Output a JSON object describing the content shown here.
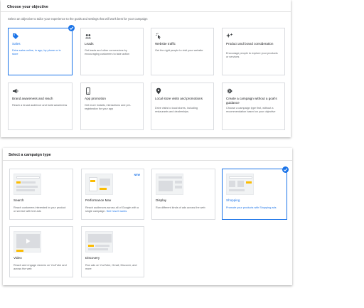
{
  "objective_panel": {
    "title": "Choose your objective",
    "subtitle": "Select an objective to tailor your experience to the goals and settings that will work best for your campaign",
    "cards": [
      {
        "icon": "tag-icon",
        "title": "Sales",
        "desc": "Drive sales online, in app, by phone or in store",
        "selected": true
      },
      {
        "icon": "people-icon",
        "title": "Leads",
        "desc": "Get leads and other conversions by encouraging customers to take action",
        "selected": false
      },
      {
        "icon": "cursor-click-icon",
        "title": "Website traffic",
        "desc": "Get the right people to visit your website",
        "selected": false
      },
      {
        "icon": "sparkle-icon",
        "title": "Product and brand consideration",
        "desc": "Encourage people to explore your products or services",
        "selected": false
      },
      {
        "icon": "megaphone-icon",
        "title": "Brand awareness and reach",
        "desc": "Reach a broad audience and build awareness",
        "selected": false
      },
      {
        "icon": "phone-icon",
        "title": "App promotion",
        "desc": "Get more installs, interactions and pre-registration for your app",
        "selected": false
      },
      {
        "icon": "location-pin-icon",
        "title": "Local store visits and promotions",
        "desc": "Drive visits to local stores, including restaurants and dealerships.",
        "selected": false
      },
      {
        "icon": "gear-icon",
        "title": "Create a campaign without a goal's guidance",
        "desc": "Choose a campaign type first, without a recommendation based on your objective",
        "selected": false
      }
    ]
  },
  "campaign_panel": {
    "title": "Select a campaign type",
    "cards": [
      {
        "thumb": "search",
        "title": "Search",
        "desc": "Reach customers interested in your product or service with text ads",
        "selected": false
      },
      {
        "thumb": "performance-max",
        "title": "Performance Max",
        "badge": "NEW",
        "desc": "Reach audiences across all of Google with a single campaign.",
        "link": "See how it works",
        "selected": false
      },
      {
        "thumb": "display",
        "title": "Display",
        "desc": "Run different kinds of ads across the web",
        "selected": false
      },
      {
        "thumb": "shopping",
        "title": "Shopping",
        "desc": "Promote your products with Shopping ads",
        "selected": true
      },
      {
        "thumb": "video",
        "title": "Video",
        "desc": "Reach and engage viewers on YouTube and across the web",
        "selected": false
      },
      {
        "thumb": "discovery",
        "title": "Discovery",
        "desc": "Run ads on YouTube, Gmail, Discover, and more",
        "selected": false
      }
    ]
  },
  "colors": {
    "accent": "#1a73e8",
    "border": "#dadce0",
    "secondary_text": "#5f6368",
    "yellow": "#fbbc04"
  }
}
